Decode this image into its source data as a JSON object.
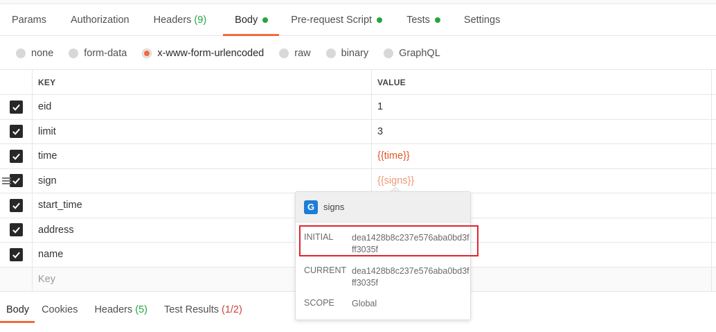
{
  "request_tabs": [
    {
      "label": "Params"
    },
    {
      "label": "Authorization"
    },
    {
      "label": "Headers",
      "count": "(9)"
    },
    {
      "label": "Body",
      "active": true
    },
    {
      "label": "Pre-request Script"
    },
    {
      "label": "Tests"
    },
    {
      "label": "Settings"
    }
  ],
  "body_types": [
    "none",
    "form-data",
    "x-www-form-urlencoded",
    "raw",
    "binary",
    "GraphQL"
  ],
  "selected_body_type": "x-www-form-urlencoded",
  "table": {
    "columns": {
      "key": "KEY",
      "value": "VALUE"
    },
    "rows": [
      {
        "key": "eid",
        "value": "1"
      },
      {
        "key": "limit",
        "value": "3"
      },
      {
        "key": "time",
        "value": "{{time}}"
      },
      {
        "key": "sign",
        "value": "{{signs}}"
      },
      {
        "key": "start_time",
        "value": ""
      },
      {
        "key": "address",
        "value": ""
      },
      {
        "key": "name",
        "value": ""
      }
    ],
    "new_key_placeholder": "Key"
  },
  "variable_popover": {
    "badge": "G",
    "name": "signs",
    "initial_label": "INITIAL",
    "initial_value": "dea1428b8c237e576aba0bd3fff3035f",
    "current_label": "CURRENT",
    "current_value": "dea1428b8c237e576aba0bd3fff3035f",
    "scope_label": "SCOPE",
    "scope_value": "Global"
  },
  "response_tabs": [
    {
      "label": "Body",
      "active": true
    },
    {
      "label": "Cookies"
    },
    {
      "label": "Headers",
      "count": "(5)"
    },
    {
      "label": "Test Results",
      "count": "(1/2)"
    }
  ],
  "colors": {
    "accent": "#f26b3a",
    "dot_green": "#26a53d",
    "error_red": "#d23f3f",
    "variable": "#e05a2b",
    "highlight": "#e0242c"
  }
}
